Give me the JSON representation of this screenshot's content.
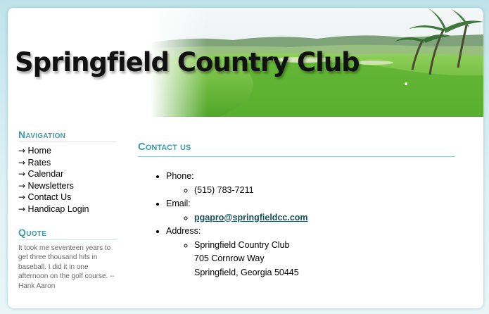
{
  "site": {
    "title": "Springfield Country Club"
  },
  "sidebar": {
    "nav_heading": "Navigation",
    "nav_items": [
      {
        "label": "Home"
      },
      {
        "label": "Rates"
      },
      {
        "label": "Calendar"
      },
      {
        "label": "Newsletters"
      },
      {
        "label": "Contact Us"
      },
      {
        "label": "Handicap Login"
      }
    ],
    "quote_heading": "Quote",
    "quote_text": "It took me seventeen years to get three thousand hits in baseball. I did it in one afternoon on the golf course. --Hank Aaron"
  },
  "content": {
    "heading": "Contact us",
    "phone_label": "Phone:",
    "phone_value": "(515) 783-7211",
    "email_label": "Email:",
    "email_value": "pgapro@springfieldcc.com",
    "address_label": "Address:",
    "address_line1": "Springfield Country Club",
    "address_line2": "705 Cornrow Way",
    "address_line3": "Springfield, Georgia 50445"
  },
  "colors": {
    "accent": "#3f9aa6",
    "link": "#1a4f59",
    "grass": "#5fb52e"
  }
}
